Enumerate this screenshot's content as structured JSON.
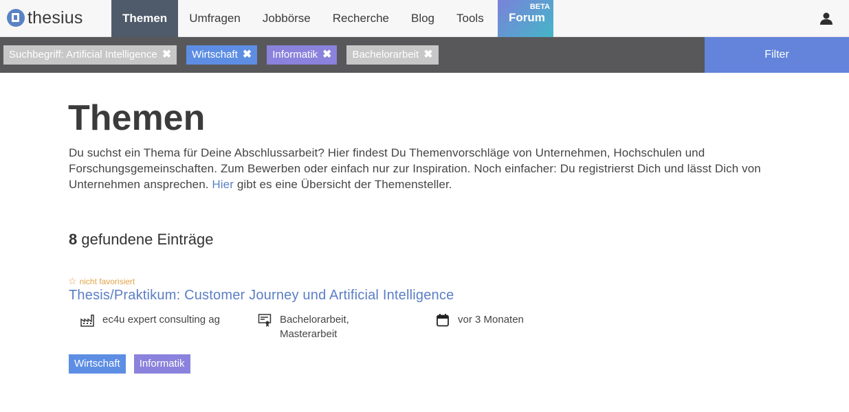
{
  "brand": {
    "name": "thesius"
  },
  "nav": {
    "items": [
      {
        "label": "Themen"
      },
      {
        "label": "Umfragen"
      },
      {
        "label": "Jobbörse"
      },
      {
        "label": "Recherche"
      },
      {
        "label": "Blog"
      },
      {
        "label": "Tools"
      }
    ],
    "forum": {
      "label": "Forum",
      "badge": "BETA"
    }
  },
  "filters": {
    "chips": [
      {
        "label": "Suchbegriff: Artificial Intelligence",
        "remove": "✖"
      },
      {
        "label": "Wirtschaft",
        "remove": "✖"
      },
      {
        "label": "Informatik",
        "remove": "✖"
      },
      {
        "label": "Bachelorarbeit",
        "remove": "✖"
      }
    ],
    "button_label": "Filter"
  },
  "main": {
    "title": "Themen",
    "intro_text": "Du suchst ein Thema für Deine Abschlussarbeit? Hier findest Du Themenvorschläge von Unternehmen, Hochschulen und Forschungsgemeinschaften. Zum Bewerben oder einfach nur zur Inspiration. Noch einfacher: Du registrierst Dich und lässt Dich von Unternehmen ansprechen.",
    "intro_link": "Hier",
    "intro_tail": "gibt es eine Übersicht der Themensteller.",
    "count_number": "8",
    "count_label": "gefundene Einträge"
  },
  "entry": {
    "favorite_label": "nicht favorisiert",
    "title": "Thesis/Praktikum: Customer Journey und Artificial Intelligence",
    "company": "ec4u expert consulting ag",
    "types": "Bachelorarbeit, Masterarbeit",
    "date": "vor 3 Monaten",
    "tags": [
      {
        "label": "Wirtschaft"
      },
      {
        "label": "Informatik"
      }
    ]
  },
  "colors": {
    "nav_active": "#4f5b6a",
    "filterbar": "#58585b",
    "filter_button": "#6384da",
    "tag_blue": "#5d8ee4",
    "tag_purple": "#8a82dc",
    "link": "#5a7ec5",
    "favorite": "#e0a34a"
  },
  "icons": {
    "user": "user-icon",
    "company": "factory-icon",
    "type": "certificate-icon",
    "date": "calendar-icon",
    "favorite": "star-outline-icon",
    "remove": "close-icon"
  }
}
